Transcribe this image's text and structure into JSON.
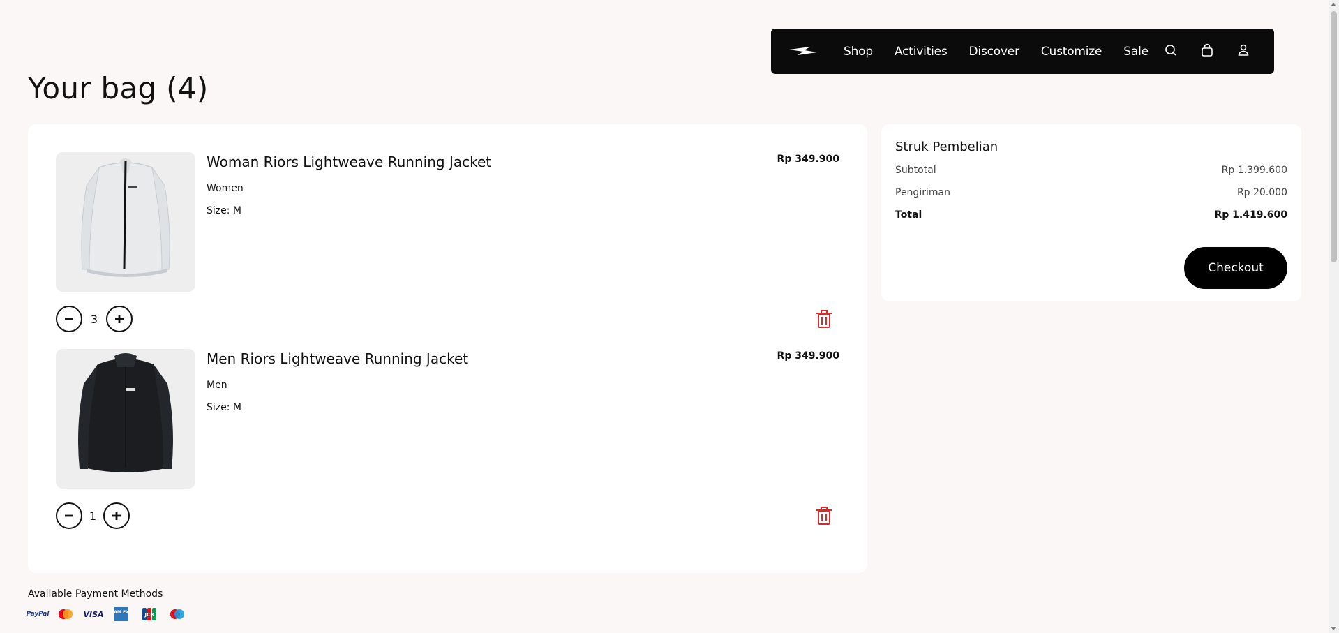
{
  "nav": {
    "links": [
      "Shop",
      "Activities",
      "Discover",
      "Customize",
      "Sale"
    ],
    "icons": [
      "search-icon",
      "shopping-bag-icon",
      "user-icon"
    ]
  },
  "page": {
    "title": "Your bag (4)"
  },
  "bag": {
    "items": [
      {
        "name": "Woman Riors Lightweave Running Jacket",
        "category": "Women",
        "size": "Size: M",
        "price": "Rp 349.900",
        "quantity": "3",
        "color": "#e8eaec"
      },
      {
        "name": "Men Riors Lightweave Running Jacket",
        "category": "Men",
        "size": "Size: M",
        "price": "Rp 349.900",
        "quantity": "1",
        "color": "#1b1d20"
      }
    ]
  },
  "receipt": {
    "title": "Struk Pembelian",
    "subtotal_label": "Subtotal",
    "subtotal_value": "Rp 1.399.600",
    "shipping_label": "Pengiriman",
    "shipping_value": "Rp 20.000",
    "total_label": "Total",
    "total_value": "Rp 1.419.600",
    "checkout_label": "Checkout"
  },
  "payments": {
    "title": "Available Payment Methods",
    "paypal": "PayPal",
    "visa": "VISA",
    "amex": "AM EX",
    "jcb": "JCB",
    "methods": [
      "paypal",
      "mastercard",
      "visa",
      "amex",
      "jcb",
      "maestro"
    ]
  },
  "colors": {
    "accent": "#000000",
    "danger": "#d32f2f",
    "background": "#fbf7f6"
  }
}
